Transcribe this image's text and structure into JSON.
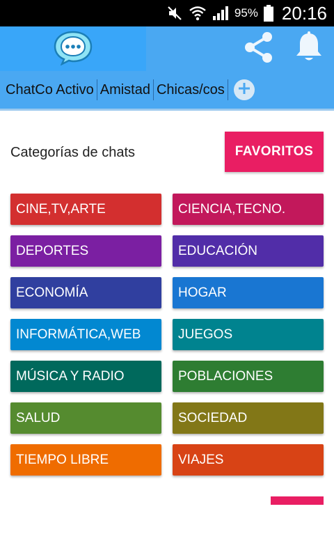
{
  "status_bar": {
    "battery_percent": "95%",
    "time": "20:16",
    "icons": [
      "mute-icon",
      "wifi-icon",
      "signal-icon",
      "battery-icon"
    ]
  },
  "app_bar": {
    "logo_icon": "chat-bubble-icon",
    "actions": [
      "share-icon",
      "bell-icon"
    ],
    "brand_color": "#4aa8f2"
  },
  "tabs": [
    {
      "label": "ChatCo Activo"
    },
    {
      "label": "Amistad"
    },
    {
      "label": "Chicas/cos"
    }
  ],
  "main": {
    "title": "Categorías de chats",
    "favorites_label": "FAVORITOS",
    "favorites_color": "#e91e63"
  },
  "categories": [
    {
      "label": "CINE,TV,ARTE",
      "color": "#d32f2f"
    },
    {
      "label": "CIENCIA,TECNO.",
      "color": "#c2185b"
    },
    {
      "label": "DEPORTES",
      "color": "#7b1fa2"
    },
    {
      "label": "EDUCACIÓN",
      "color": "#512da8"
    },
    {
      "label": "ECONOMÍA",
      "color": "#303f9f"
    },
    {
      "label": "HOGAR",
      "color": "#1976d2"
    },
    {
      "label": "INFORMÁTICA,WEB",
      "color": "#0288d1"
    },
    {
      "label": "JUEGOS",
      "color": "#00838f"
    },
    {
      "label": "MÚSICA Y RADIO",
      "color": "#00695c"
    },
    {
      "label": "POBLACIONES",
      "color": "#2e7d32"
    },
    {
      "label": "SALUD",
      "color": "#558b2f"
    },
    {
      "label": "SOCIEDAD",
      "color": "#827717"
    },
    {
      "label": "TIEMPO LIBRE",
      "color": "#ef6c00"
    },
    {
      "label": "VIAJES",
      "color": "#d84315"
    }
  ]
}
